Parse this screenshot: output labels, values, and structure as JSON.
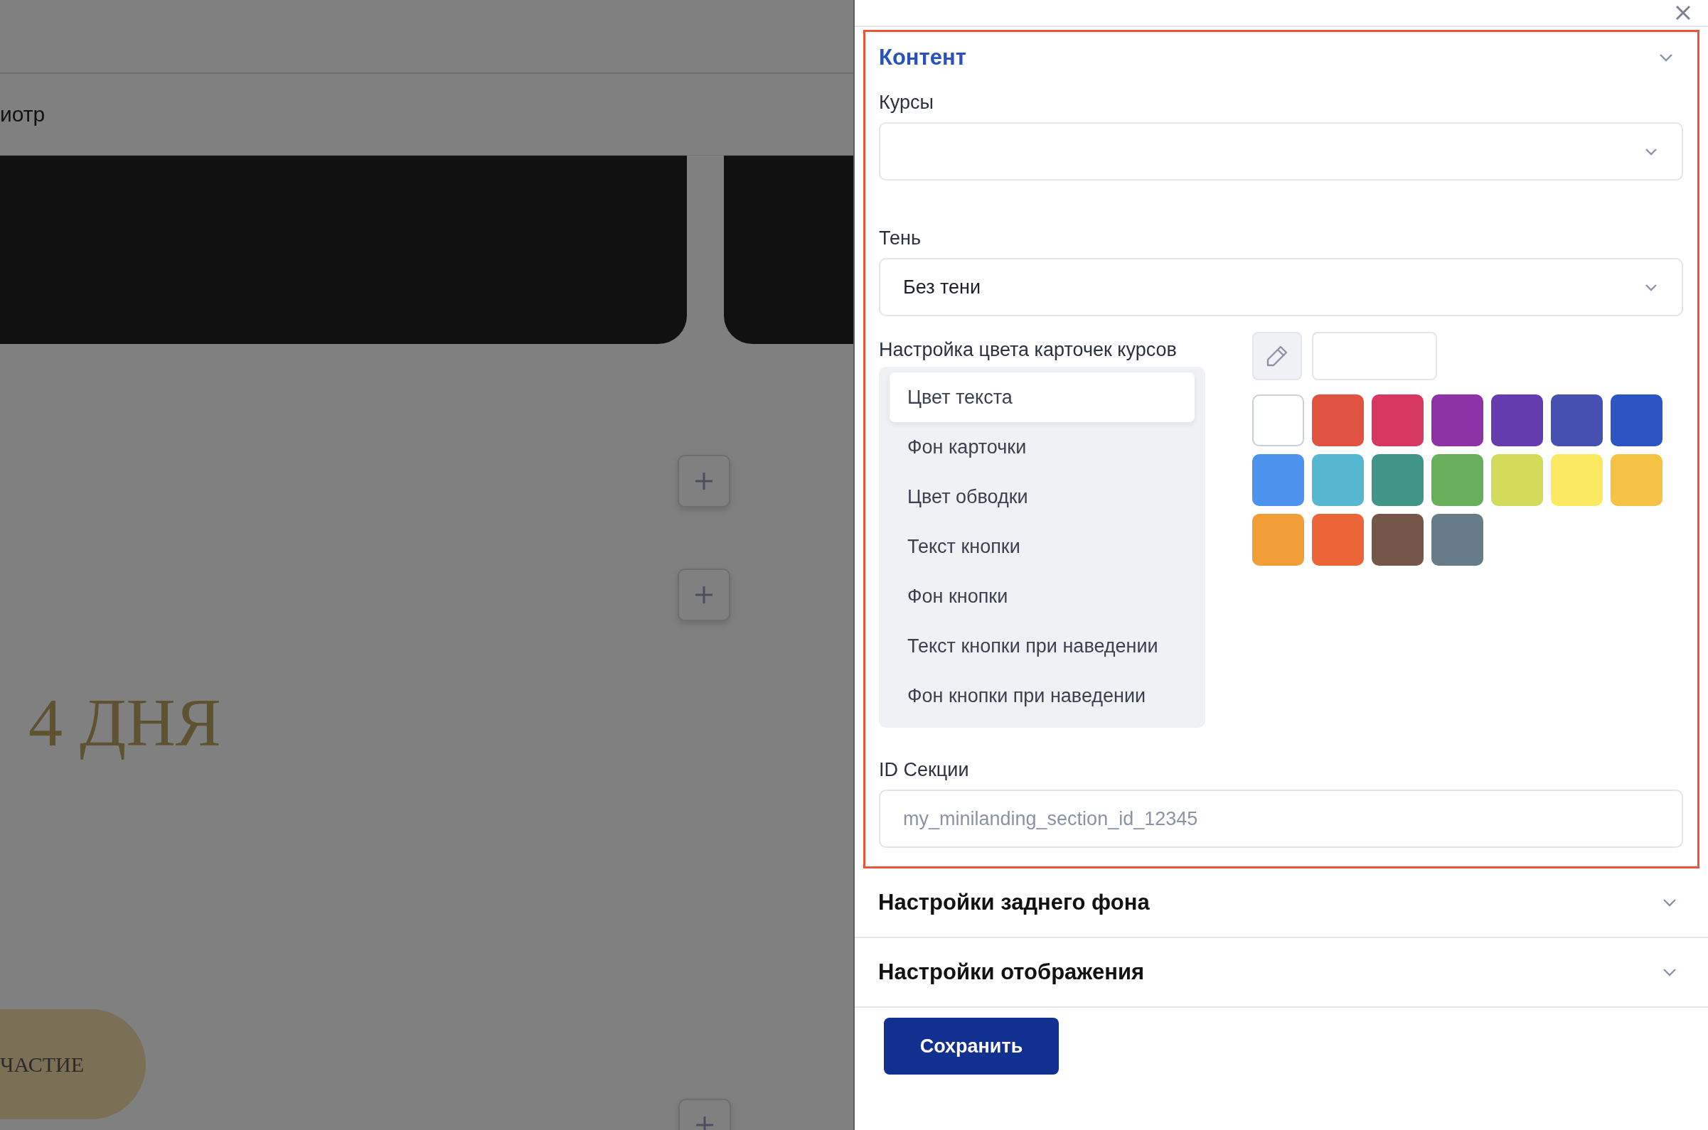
{
  "background_page": {
    "nav_text": "иотр",
    "headline": "4 ДНЯ",
    "cta_button": "ЧАСТИЕ"
  },
  "panel": {
    "content_section": {
      "title": "Контент",
      "expanded": true,
      "courses": {
        "label": "Курсы"
      },
      "shadow": {
        "label": "Тень",
        "value": "Без тени"
      },
      "card_colors": {
        "label": "Настройка цвета карточек курсов",
        "targets": [
          {
            "label": "Цвет текста",
            "selected": true
          },
          {
            "label": "Фон карточки",
            "selected": false
          },
          {
            "label": "Цвет обводки",
            "selected": false
          },
          {
            "label": "Текст кнопки",
            "selected": false
          },
          {
            "label": "Фон кнопки",
            "selected": false
          },
          {
            "label": "Текст кнопки при наведении",
            "selected": false
          },
          {
            "label": "Фон кнопки при наведении",
            "selected": false
          }
        ],
        "swatches": [
          {
            "color": "#ffffff"
          },
          {
            "color": "#e05340"
          },
          {
            "color": "#d63862"
          },
          {
            "color": "#8e32a8"
          },
          {
            "color": "#653bb0"
          },
          {
            "color": "#4550b0"
          },
          {
            "color": "#2c55c4"
          },
          {
            "color": "#4b93ec"
          },
          {
            "color": "#55b8d0"
          },
          {
            "color": "#419587"
          },
          {
            "color": "#69ae5a"
          },
          {
            "color": "#d2dc5a"
          },
          {
            "color": "#fbe962"
          },
          {
            "color": "#f5c344"
          },
          {
            "color": "#f19d38"
          },
          {
            "color": "#ec6538"
          },
          {
            "color": "#75574a"
          },
          {
            "color": "#677c89"
          }
        ]
      },
      "section_id": {
        "label": "ID Секции",
        "placeholder": "my_minilanding_section_id_12345"
      }
    },
    "collapsed_sections": [
      {
        "title": "Настройки заднего фона",
        "expanded": false
      },
      {
        "title": "Настройки отображения",
        "expanded": false
      }
    ],
    "save_button": "Сохранить"
  }
}
